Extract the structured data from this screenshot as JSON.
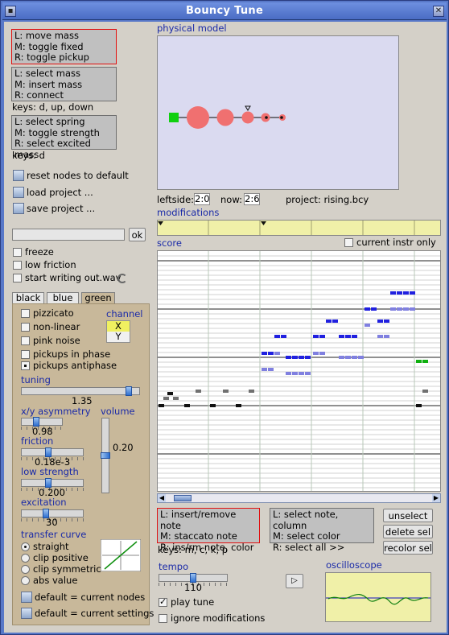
{
  "window": {
    "title": "Bouncy Tune"
  },
  "left": {
    "mass_help": [
      "L: move mass",
      "M: toggle fixed",
      "R: toggle pickup"
    ],
    "select_help": [
      "L: select mass",
      "M: insert mass",
      "R: connect"
    ],
    "select_keys": "keys: d, up, down",
    "spring_help": [
      "L: select spring",
      "M: toggle strength",
      "R: select excited mass"
    ],
    "spring_keys": "keys: d",
    "buttons": [
      "reset nodes to default",
      "load project ...",
      "save project ..."
    ],
    "text_input": "",
    "ok_label": "ok",
    "checks": [
      {
        "label": "freeze",
        "checked": false
      },
      {
        "label": "low friction",
        "checked": false
      },
      {
        "label": "start writing out.wav",
        "checked": false
      }
    ]
  },
  "tabs": [
    "black",
    "blue",
    "green"
  ],
  "instr": {
    "checks": [
      {
        "label": "pizzicato",
        "checked": false
      },
      {
        "label": "non-linear",
        "checked": false
      },
      {
        "label": "pink noise",
        "checked": false
      },
      {
        "label": "pickups in phase",
        "checked": false
      },
      {
        "label": "pickups antiphase",
        "checked": true
      }
    ],
    "channel_label": "channel",
    "channel_x": "X",
    "channel_y": "Y",
    "tuning_label": "tuning",
    "tuning_value": "1.35",
    "xy_label": "x/y asymmetry",
    "xy_value": "0.98",
    "volume_label": "volume",
    "volume_value": "0.20",
    "friction_label": "friction",
    "friction_value": "0.18e-3",
    "lowstrength_label": "low strength",
    "lowstrength_value": "0.200",
    "excitation_label": "excitation",
    "excitation_value": "30",
    "transfer_label": "transfer curve",
    "transfer_options": [
      "straight",
      "clip positive",
      "clip symmetric",
      "abs value"
    ],
    "transfer_selected": "straight",
    "default_buttons": [
      "default = current nodes",
      "default = current settings"
    ]
  },
  "model": {
    "title": "physical model",
    "leftside_label": "leftside:",
    "leftside_value": "2:0",
    "now_label": "now:",
    "now_value": "2:6",
    "project_label": "project: rising.bcy"
  },
  "mods": {
    "title": "modifications"
  },
  "score": {
    "title": "score",
    "current_instr_only": "current instr only",
    "colors": {
      "blue": "#2020e0",
      "lightblue": "#8080e0",
      "green": "#10b010",
      "black": "#111111",
      "grey": "#707070"
    }
  },
  "bottom": {
    "note_help": [
      "L: insert/remove note",
      "M: staccato note",
      "R: ins/rm note, color"
    ],
    "note_keys": "keys: m, c, k, p",
    "select_help": [
      "L: select note, column",
      "M: select color",
      "R: select all >>"
    ],
    "unselect": "unselect",
    "delete_sel": "delete sel",
    "recolor_sel": "recolor sel",
    "tempo_label": "tempo",
    "tempo_value": "110",
    "play_icon": "play-icon",
    "oscilloscope_label": "oscilloscope",
    "play_tune": {
      "label": "play tune",
      "checked": true
    },
    "ignore_mods": {
      "label": "ignore modifications",
      "checked": false
    }
  }
}
